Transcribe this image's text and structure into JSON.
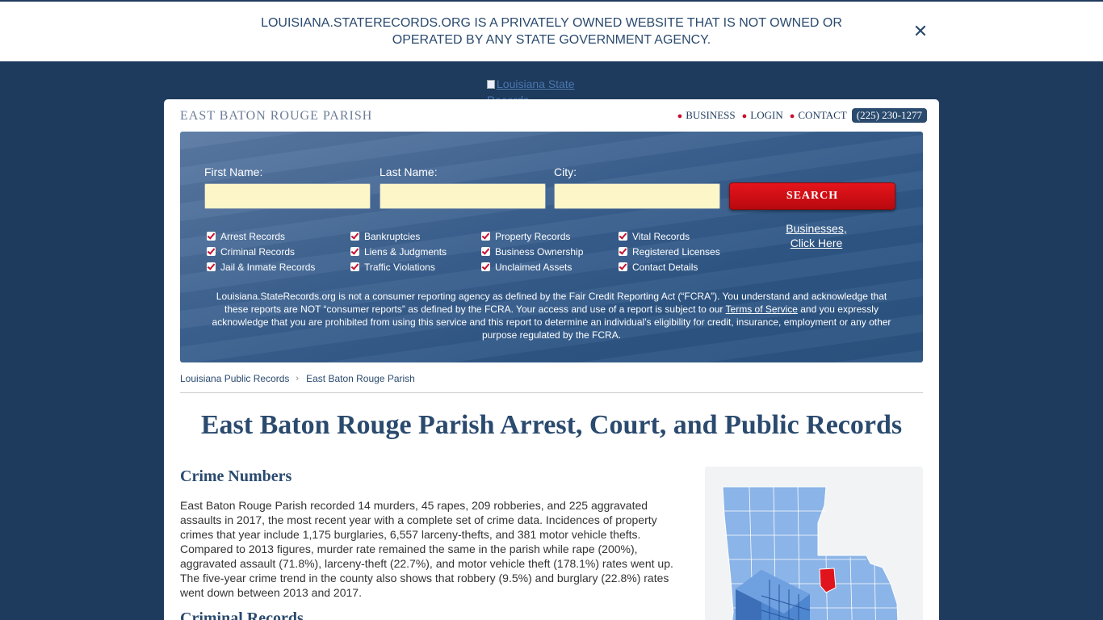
{
  "notice": {
    "line1": "LOUISIANA.STATERECORDS.ORG IS A PRIVATELY OWNED WEBSITE THAT IS NOT OWNED OR",
    "line2": "OPERATED BY ANY STATE GOVERNMENT AGENCY.",
    "close_icon": "close-icon",
    "close_glyph": "✕"
  },
  "logo": {
    "alt_line1": "Louisiana State",
    "alt_line2": "Records"
  },
  "header": {
    "parish": "EAST BATON ROUGE PARISH",
    "nav": [
      "BUSINESS",
      "LOGIN",
      "CONTACT"
    ],
    "phone": "(225) 230-1277"
  },
  "search": {
    "first_name_label": "First Name:",
    "last_name_label": "Last Name:",
    "city_label": "City:",
    "first_name_value": "",
    "last_name_value": "",
    "city_value": "",
    "button_label": "SEARCH",
    "checkbox_columns": [
      [
        "Arrest Records",
        "Criminal Records",
        "Jail & Inmate Records"
      ],
      [
        "Bankruptcies",
        "Liens & Judgments",
        "Traffic Violations"
      ],
      [
        "Property Records",
        "Business Ownership",
        "Unclaimed Assets"
      ],
      [
        "Vital Records",
        "Registered Licenses",
        "Contact Details"
      ]
    ],
    "biz_line1": "Businesses,",
    "biz_line2": "Click Here"
  },
  "fcra": {
    "part1": "Louisiana.StateRecords.org is not a consumer reporting agency as defined by the Fair Credit Reporting Act (“FCRA”). You understand and acknowledge that these reports are NOT “consumer reports” as defined by the FCRA. Your access and use of a report is subject to our ",
    "link": "Terms of Service",
    "part2": " and you expressly acknowledge that you are prohibited from using this service and this report to determine an individual’s eligibility for credit, insurance, employment or any other purpose regulated by the FCRA."
  },
  "breadcrumb": {
    "home": "Louisiana Public Records",
    "current": "East Baton Rouge Parish",
    "separator": "›"
  },
  "page_title": "East Baton Rouge Parish Arrest, Court, and Public Records",
  "crime": {
    "heading": "Crime Numbers",
    "text": "East Baton Rouge Parish recorded 14 murders, 45 rapes, 209 robberies, and 225 aggravated assaults in 2017, the most recent year with a complete set of crime data. Incidences of property crimes that year include 1,175 burglaries, 6,557 larceny-thefts, and 381 motor vehicle thefts. Compared to 2013 figures, murder rate remained the same in the parish while rape (200%), aggravated assault (71.8%), larceny-theft (22.7%), and motor vehicle theft (178.1%) rates went up. The five-year crime trend in the county also shows that robbery (9.5%) and burglary (22.8%) rates went down between 2013 and 2017."
  },
  "next_heading": "Criminal Records",
  "colors": {
    "brand": "#1e3a5c",
    "accent": "#c8102e",
    "input_bg": "#fdf6c9",
    "map_state": "#8bb4e8",
    "map_highlight": "#e0141c"
  }
}
